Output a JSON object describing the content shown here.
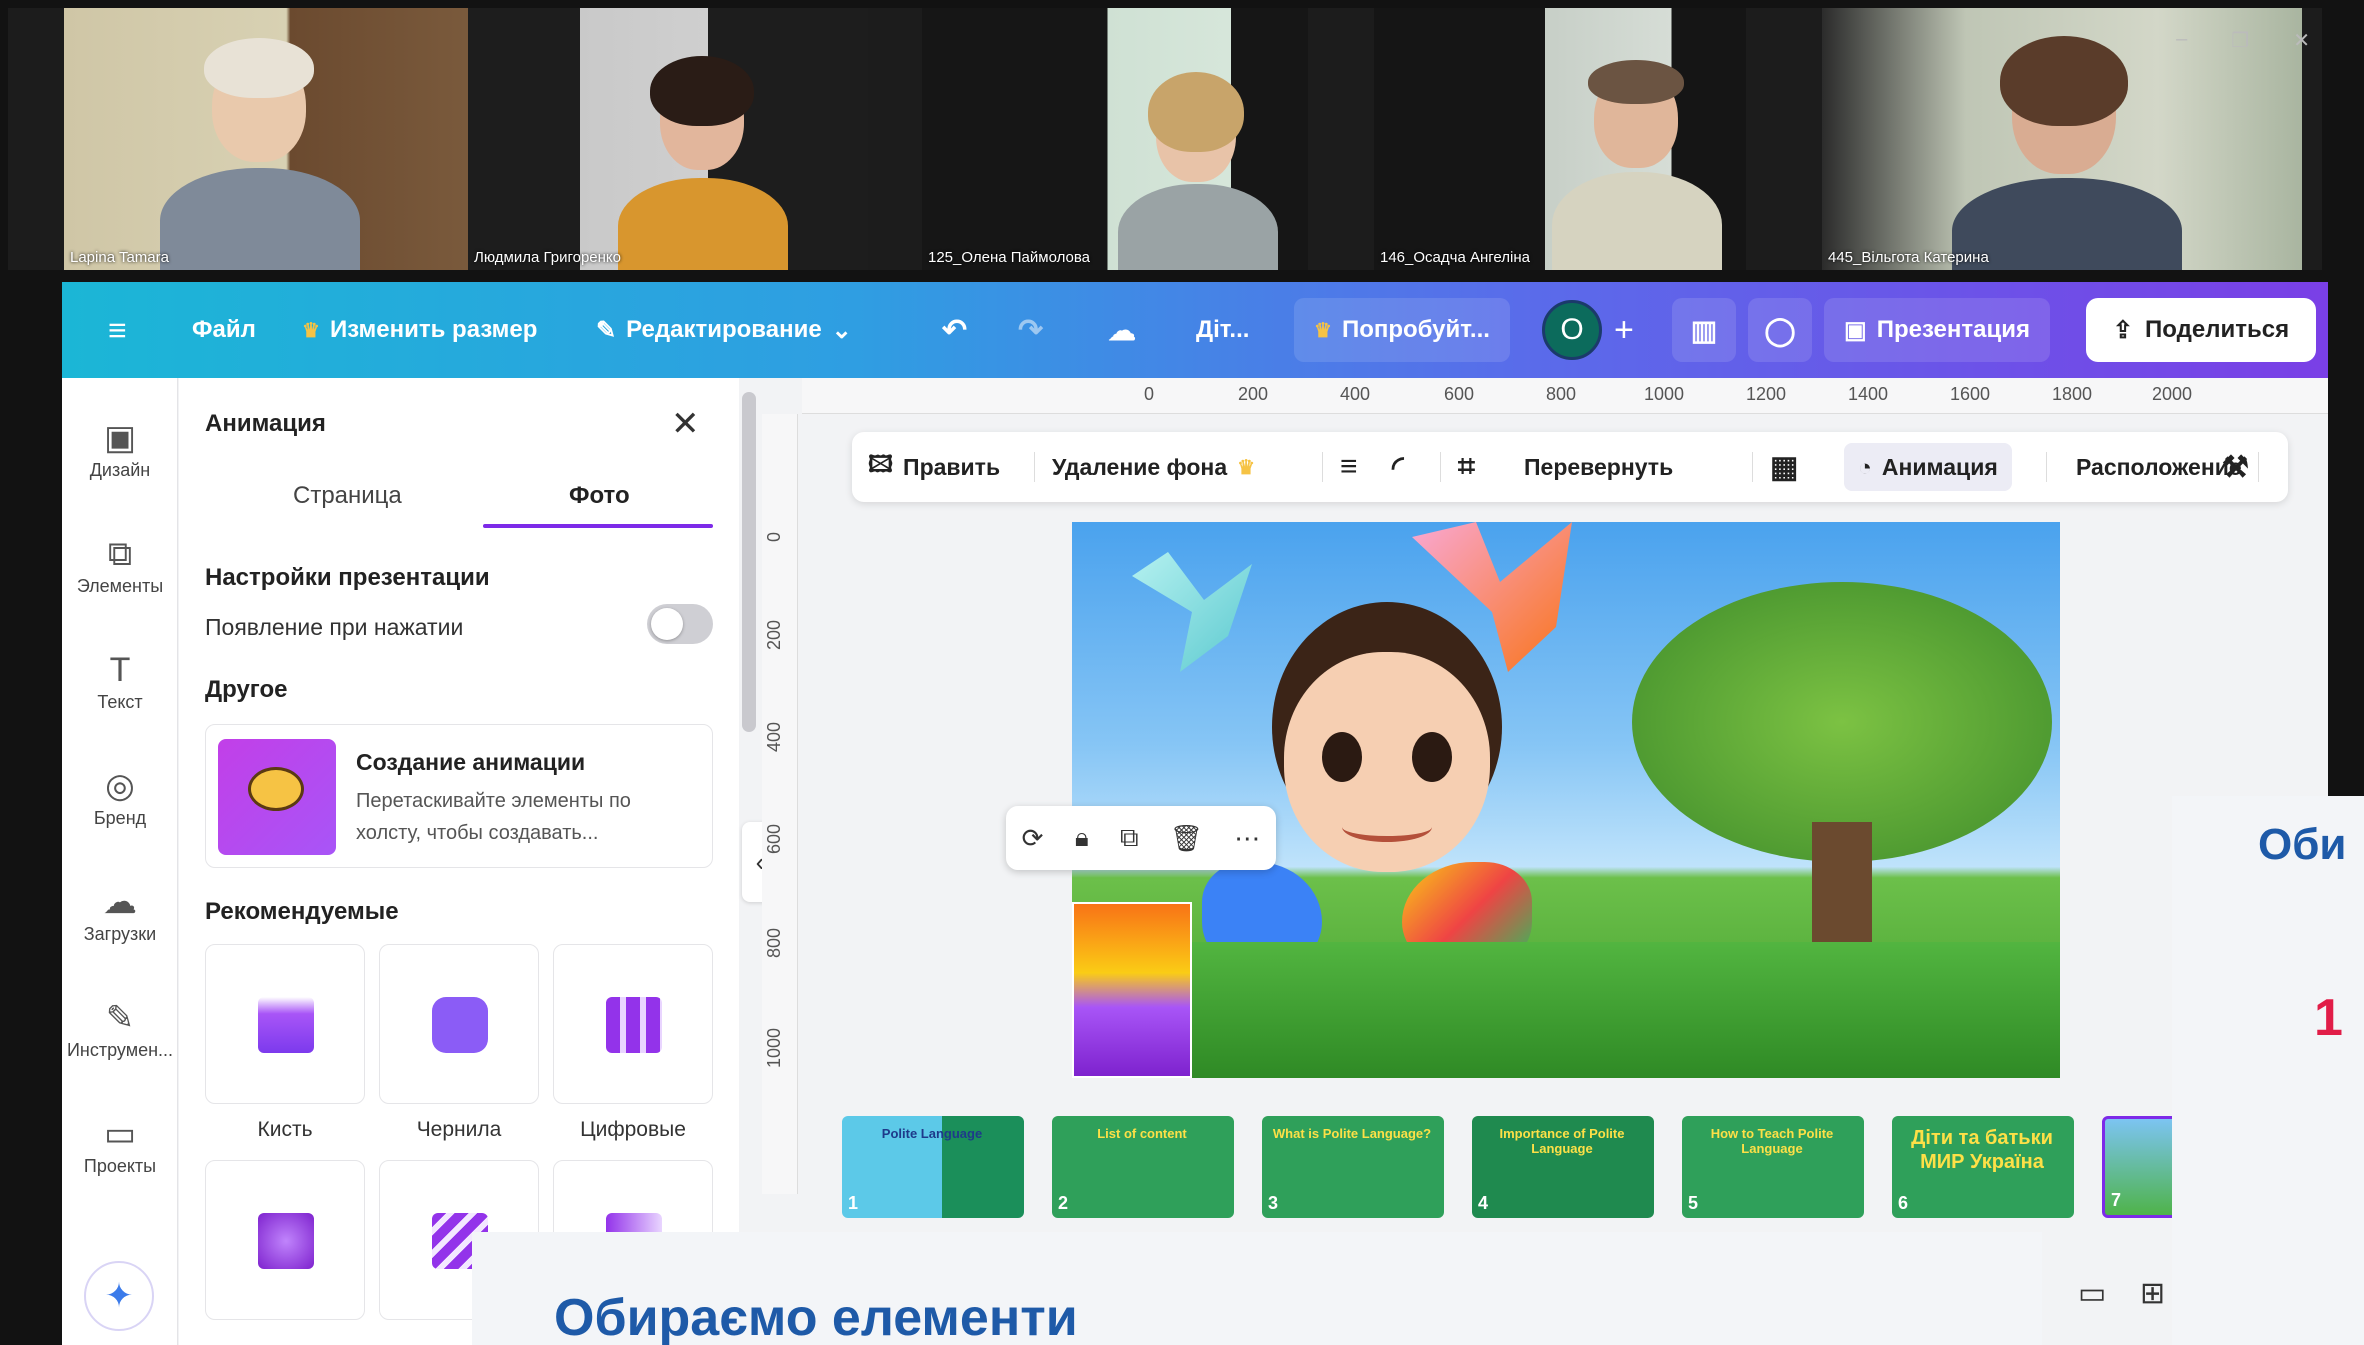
{
  "participants": [
    {
      "name": "Lapina Tamara"
    },
    {
      "name": "Людмила Григоренко"
    },
    {
      "name": "125_Олена Паймолова"
    },
    {
      "name": "146_Осадча Ангеліна"
    },
    {
      "name": "445_Вільгота Катерина"
    }
  ],
  "window_controls": {
    "minimize": "–",
    "restore": "❐",
    "close": "✕"
  },
  "topbar": {
    "menu_icon": "≡",
    "file": "Файл",
    "resize": "Изменить размер",
    "editing": "Редактирование",
    "cloud_label": "Діт...",
    "try": "Попробуйт...",
    "avatar": "O",
    "add": "+",
    "presentation": "Презентация",
    "share": "Поделиться"
  },
  "rail": [
    {
      "label": "Дизайн",
      "icon": "▣"
    },
    {
      "label": "Элементы",
      "icon": "⧉"
    },
    {
      "label": "Текст",
      "icon": "T"
    },
    {
      "label": "Бренд",
      "icon": "◎"
    },
    {
      "label": "Загрузки",
      "icon": "☁"
    },
    {
      "label": "Инструмен...",
      "icon": "✎"
    },
    {
      "label": "Проекты",
      "icon": "▭"
    }
  ],
  "panel": {
    "title": "Анимация",
    "close": "✕",
    "tabs": [
      "Страница",
      "Фото"
    ],
    "presentation_settings": "Настройки презентации",
    "appear_on_click": "Появление при нажатии",
    "other": "Другое",
    "create_title": "Создание анимации",
    "create_desc": "Перетаскивайте элементы по холсту, чтобы создавать...",
    "recommended": "Рекомендуемые",
    "animations": [
      "Кисть",
      "Чернила",
      "Цифровые"
    ]
  },
  "ruler_top": [
    "0",
    "200",
    "400",
    "600",
    "800",
    "1000",
    "1200",
    "1400",
    "1600",
    "1800",
    "2000"
  ],
  "ruler_left": [
    "0",
    "200",
    "400",
    "600",
    "800",
    "1000"
  ],
  "context_toolbar": {
    "edit": "Править",
    "remove_bg": "Удаление фона",
    "flip": "Перевернуть",
    "animation": "Анимация",
    "position": "Расположение"
  },
  "thumbnails": [
    {
      "num": "1",
      "title": "Polite Language"
    },
    {
      "num": "2",
      "title": "List of content"
    },
    {
      "num": "3",
      "title": "What is Polite Language?"
    },
    {
      "num": "4",
      "title": "Importance of Polite Language"
    },
    {
      "num": "5",
      "title": "How to Teach Polite Language"
    },
    {
      "num": "6",
      "title": "Діти та батьки МИР Україна"
    },
    {
      "num": "7",
      "title": ""
    }
  ],
  "overlay_slide": {
    "heading": "Обираємо елементи"
  },
  "right_slide": {
    "heading": "Оби",
    "marker": "1"
  },
  "colors": {
    "accent": "#7d2ae8",
    "topbar_start": "#1bb6d6",
    "topbar_end": "#7a3fe6",
    "heading_blue": "#1e5aa8"
  }
}
